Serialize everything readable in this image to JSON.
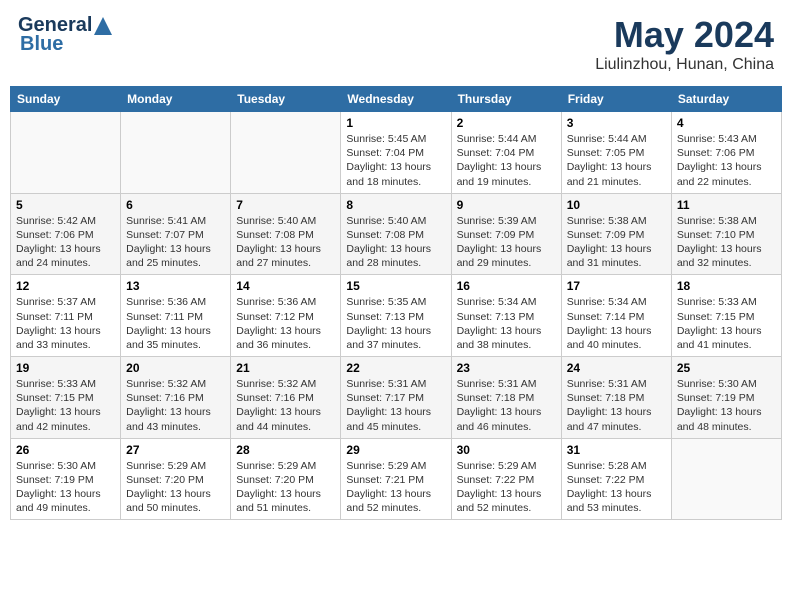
{
  "header": {
    "logo_general": "General",
    "logo_blue": "Blue",
    "title": "May 2024",
    "subtitle": "Liulinzhou, Hunan, China"
  },
  "days_of_week": [
    "Sunday",
    "Monday",
    "Tuesday",
    "Wednesday",
    "Thursday",
    "Friday",
    "Saturday"
  ],
  "weeks": [
    [
      {
        "day": "",
        "info": ""
      },
      {
        "day": "",
        "info": ""
      },
      {
        "day": "",
        "info": ""
      },
      {
        "day": "1",
        "info": "Sunrise: 5:45 AM\nSunset: 7:04 PM\nDaylight: 13 hours\nand 18 minutes."
      },
      {
        "day": "2",
        "info": "Sunrise: 5:44 AM\nSunset: 7:04 PM\nDaylight: 13 hours\nand 19 minutes."
      },
      {
        "day": "3",
        "info": "Sunrise: 5:44 AM\nSunset: 7:05 PM\nDaylight: 13 hours\nand 21 minutes."
      },
      {
        "day": "4",
        "info": "Sunrise: 5:43 AM\nSunset: 7:06 PM\nDaylight: 13 hours\nand 22 minutes."
      }
    ],
    [
      {
        "day": "5",
        "info": "Sunrise: 5:42 AM\nSunset: 7:06 PM\nDaylight: 13 hours\nand 24 minutes."
      },
      {
        "day": "6",
        "info": "Sunrise: 5:41 AM\nSunset: 7:07 PM\nDaylight: 13 hours\nand 25 minutes."
      },
      {
        "day": "7",
        "info": "Sunrise: 5:40 AM\nSunset: 7:08 PM\nDaylight: 13 hours\nand 27 minutes."
      },
      {
        "day": "8",
        "info": "Sunrise: 5:40 AM\nSunset: 7:08 PM\nDaylight: 13 hours\nand 28 minutes."
      },
      {
        "day": "9",
        "info": "Sunrise: 5:39 AM\nSunset: 7:09 PM\nDaylight: 13 hours\nand 29 minutes."
      },
      {
        "day": "10",
        "info": "Sunrise: 5:38 AM\nSunset: 7:09 PM\nDaylight: 13 hours\nand 31 minutes."
      },
      {
        "day": "11",
        "info": "Sunrise: 5:38 AM\nSunset: 7:10 PM\nDaylight: 13 hours\nand 32 minutes."
      }
    ],
    [
      {
        "day": "12",
        "info": "Sunrise: 5:37 AM\nSunset: 7:11 PM\nDaylight: 13 hours\nand 33 minutes."
      },
      {
        "day": "13",
        "info": "Sunrise: 5:36 AM\nSunset: 7:11 PM\nDaylight: 13 hours\nand 35 minutes."
      },
      {
        "day": "14",
        "info": "Sunrise: 5:36 AM\nSunset: 7:12 PM\nDaylight: 13 hours\nand 36 minutes."
      },
      {
        "day": "15",
        "info": "Sunrise: 5:35 AM\nSunset: 7:13 PM\nDaylight: 13 hours\nand 37 minutes."
      },
      {
        "day": "16",
        "info": "Sunrise: 5:34 AM\nSunset: 7:13 PM\nDaylight: 13 hours\nand 38 minutes."
      },
      {
        "day": "17",
        "info": "Sunrise: 5:34 AM\nSunset: 7:14 PM\nDaylight: 13 hours\nand 40 minutes."
      },
      {
        "day": "18",
        "info": "Sunrise: 5:33 AM\nSunset: 7:15 PM\nDaylight: 13 hours\nand 41 minutes."
      }
    ],
    [
      {
        "day": "19",
        "info": "Sunrise: 5:33 AM\nSunset: 7:15 PM\nDaylight: 13 hours\nand 42 minutes."
      },
      {
        "day": "20",
        "info": "Sunrise: 5:32 AM\nSunset: 7:16 PM\nDaylight: 13 hours\nand 43 minutes."
      },
      {
        "day": "21",
        "info": "Sunrise: 5:32 AM\nSunset: 7:16 PM\nDaylight: 13 hours\nand 44 minutes."
      },
      {
        "day": "22",
        "info": "Sunrise: 5:31 AM\nSunset: 7:17 PM\nDaylight: 13 hours\nand 45 minutes."
      },
      {
        "day": "23",
        "info": "Sunrise: 5:31 AM\nSunset: 7:18 PM\nDaylight: 13 hours\nand 46 minutes."
      },
      {
        "day": "24",
        "info": "Sunrise: 5:31 AM\nSunset: 7:18 PM\nDaylight: 13 hours\nand 47 minutes."
      },
      {
        "day": "25",
        "info": "Sunrise: 5:30 AM\nSunset: 7:19 PM\nDaylight: 13 hours\nand 48 minutes."
      }
    ],
    [
      {
        "day": "26",
        "info": "Sunrise: 5:30 AM\nSunset: 7:19 PM\nDaylight: 13 hours\nand 49 minutes."
      },
      {
        "day": "27",
        "info": "Sunrise: 5:29 AM\nSunset: 7:20 PM\nDaylight: 13 hours\nand 50 minutes."
      },
      {
        "day": "28",
        "info": "Sunrise: 5:29 AM\nSunset: 7:20 PM\nDaylight: 13 hours\nand 51 minutes."
      },
      {
        "day": "29",
        "info": "Sunrise: 5:29 AM\nSunset: 7:21 PM\nDaylight: 13 hours\nand 52 minutes."
      },
      {
        "day": "30",
        "info": "Sunrise: 5:29 AM\nSunset: 7:22 PM\nDaylight: 13 hours\nand 52 minutes."
      },
      {
        "day": "31",
        "info": "Sunrise: 5:28 AM\nSunset: 7:22 PM\nDaylight: 13 hours\nand 53 minutes."
      },
      {
        "day": "",
        "info": ""
      }
    ]
  ]
}
